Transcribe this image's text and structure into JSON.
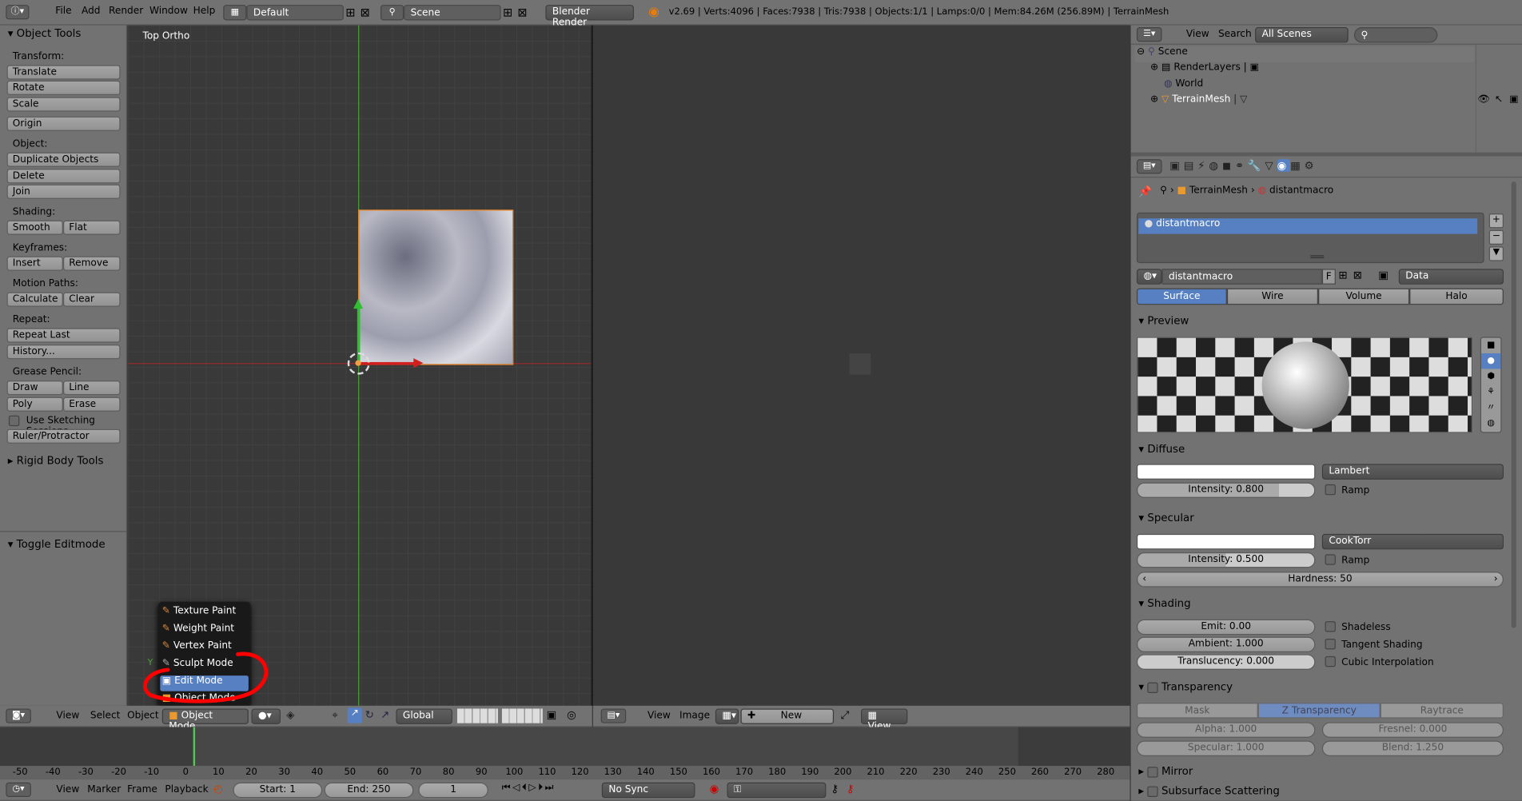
{
  "topbar": {
    "menus": [
      "File",
      "Add",
      "Render",
      "Window",
      "Help"
    ],
    "screen_layout": "Default",
    "scene": "Scene",
    "render_engine": "Blender Render",
    "stats": "v2.69 | Verts:4096 | Faces:7938 | Tris:7938 | Objects:1/1 | Lamps:0/0 | Mem:84.26M (256.89M) | TerrainMesh"
  },
  "toolshelf": {
    "title": "Object Tools",
    "transform_label": "Transform:",
    "translate": "Translate",
    "rotate": "Rotate",
    "scale": "Scale",
    "origin": "Origin",
    "object_label": "Object:",
    "duplicate": "Duplicate Objects",
    "delete": "Delete",
    "join": "Join",
    "shading_label": "Shading:",
    "smooth": "Smooth",
    "flat": "Flat",
    "keyframes_label": "Keyframes:",
    "insert": "Insert",
    "remove": "Remove",
    "motion_label": "Motion Paths:",
    "calculate": "Calculate",
    "clear": "Clear",
    "repeat_label": "Repeat:",
    "repeat_last": "Repeat Last",
    "history": "History...",
    "grease_label": "Grease Pencil:",
    "draw": "Draw",
    "line": "Line",
    "poly": "Poly",
    "erase": "Erase",
    "sketching": "Use Sketching Sessions",
    "ruler": "Ruler/Protractor",
    "rigid": "Rigid Body Tools",
    "toggle_edit": "Toggle Editmode"
  },
  "viewport": {
    "label": "Top Ortho",
    "axis_y": "Y"
  },
  "mode_menu": {
    "items": [
      "Texture Paint",
      "Weight Paint",
      "Vertex Paint",
      "Sculpt Mode",
      "Edit Mode",
      "Object Mode"
    ],
    "selected": "Edit Mode"
  },
  "view3d_header": {
    "view": "View",
    "select": "Select",
    "object": "Object",
    "mode": "Object Mode",
    "orientation": "Global"
  },
  "image_header": {
    "view": "View",
    "image": "Image",
    "new": "New",
    "view2": "View"
  },
  "timeline": {
    "ticks": [
      "-50",
      "-40",
      "-30",
      "-20",
      "-10",
      "0",
      "10",
      "20",
      "30",
      "40",
      "50",
      "60",
      "70",
      "80",
      "90",
      "100",
      "110",
      "120",
      "130",
      "140",
      "150",
      "160",
      "170",
      "180",
      "190",
      "200",
      "210",
      "220",
      "230",
      "240",
      "250",
      "260",
      "270",
      "280"
    ],
    "view": "View",
    "marker": "Marker",
    "frame": "Frame",
    "playback": "Playback",
    "start": "Start: 1",
    "end": "End: 250",
    "current": "1",
    "sync": "No Sync"
  },
  "outliner": {
    "view": "View",
    "search": "Search",
    "filter": "All Scenes",
    "items": [
      "Scene",
      "RenderLayers",
      "World",
      "TerrainMesh"
    ]
  },
  "properties": {
    "breadcrumb_object": "TerrainMesh",
    "breadcrumb_material": "distantmacro",
    "slot_name": "distantmacro",
    "material_name": "distantmacro",
    "fake_user": "F",
    "link": "Data",
    "tabs": [
      "Surface",
      "Wire",
      "Volume",
      "Halo"
    ],
    "preview_head": "Preview",
    "diffuse_head": "Diffuse",
    "diffuse_shader": "Lambert",
    "diffuse_intensity": "Intensity: 0.800",
    "ramp": "Ramp",
    "specular_head": "Specular",
    "specular_shader": "CookTorr",
    "specular_intensity": "Intensity: 0.500",
    "hardness": "Hardness: 50",
    "shading_head": "Shading",
    "emit": "Emit: 0.00",
    "ambient": "Ambient: 1.000",
    "translucency": "Translucency: 0.000",
    "shadeless": "Shadeless",
    "tangent": "Tangent Shading",
    "cubic": "Cubic Interpolation",
    "transparency_head": "Transparency",
    "mask": "Mask",
    "ztrans": "Z Transparency",
    "raytrace": "Raytrace",
    "alpha": "Alpha: 1.000",
    "fresnel": "Fresnel: 0.000",
    "specular_t": "Specular: 1.000",
    "blend": "Blend: 1.250",
    "mirror_head": "Mirror",
    "sss_head": "Subsurface Scattering"
  },
  "colors": {
    "header_bg": "#727272",
    "panel_bg": "#727272",
    "viewport_bg": "#393939",
    "selected_blue": "#5680c2",
    "annotation_red": "#ff0000",
    "mesh_outline": "#f08c2a"
  }
}
